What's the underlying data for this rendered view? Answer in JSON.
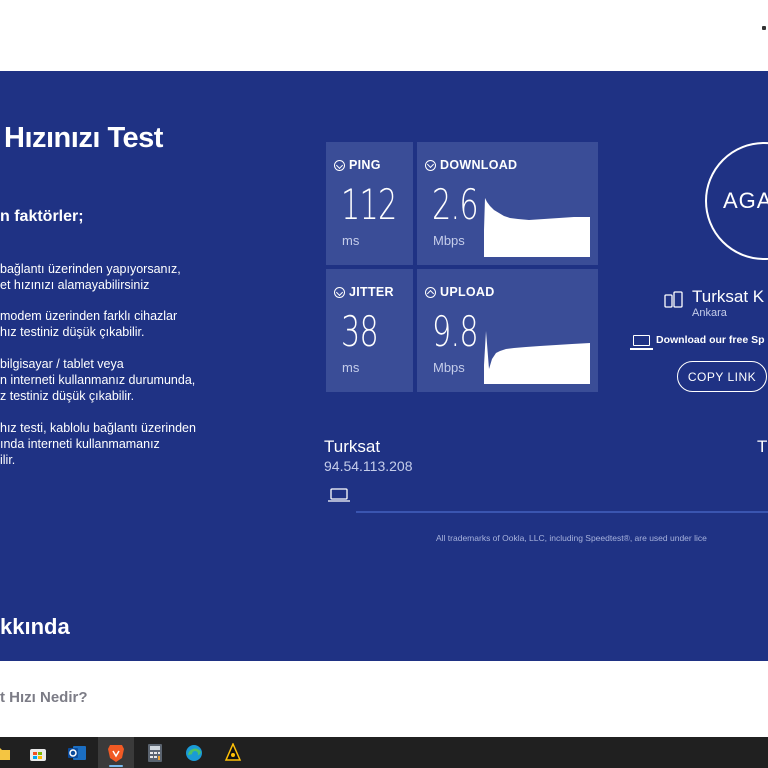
{
  "hero": {
    "title": "Hızınızı Test",
    "subtitle": "n faktörler;",
    "paragraphs": [
      [
        "bağlantı üzerinden yapıyorsanız,",
        "et hızınızı alamayabilirsiniz"
      ],
      [
        "modem üzerinden farklı cihazlar",
        "hız testiniz düşük çıkabilir."
      ],
      [
        "bilgisayar / tablet veya",
        "n interneti kullanmanız durumunda,",
        "z testiniz düşük çıkabilir."
      ],
      [
        "hız testi, kablolu bağlantı üzerinden",
        "ında interneti kullanmamanız",
        "ilir."
      ]
    ],
    "about_heading": "kkında"
  },
  "speedtest": {
    "ping": {
      "label": "PING",
      "value": "112",
      "unit": "ms"
    },
    "jitter": {
      "label": "JITTER",
      "value": "38",
      "unit": "ms"
    },
    "download": {
      "label": "DOWNLOAD",
      "value": "2.6",
      "unit": "Mbps"
    },
    "upload": {
      "label": "UPLOAD",
      "value": "9.8",
      "unit": "Mbps"
    },
    "go_button": "AGA",
    "isp_name": "Turksat K",
    "isp_location": "Ankara",
    "download_app": "Download our free Sp",
    "copy_link": "COPY LINK",
    "server_name": "Turksat",
    "server_ip": "94.54.113.208",
    "server_right": "T",
    "trademark": "All trademarks of Ookla, LLC, including Speedtest®, are used under lice"
  },
  "below": {
    "heading": "t Hızı Nedir?"
  },
  "colors": {
    "hero_bg": "#1f3284",
    "tile_bg": "#3a4d97",
    "taskbar_bg": "#202020"
  },
  "taskbar": {
    "icons": [
      "folder-icon",
      "store-icon",
      "outlook-icon",
      "brave-icon",
      "calculator-icon",
      "edge-icon",
      "app-icon"
    ]
  }
}
